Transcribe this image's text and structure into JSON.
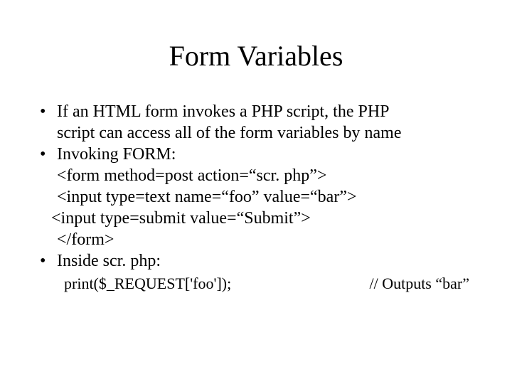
{
  "title": "Form Variables",
  "bullet1_line1": "If an HTML form invokes a PHP script, the PHP",
  "bullet1_line2": "script can access all of the form variables by name",
  "bullet2": "Invoking FORM:",
  "form_line1": "<form method=post action=“scr. php”>",
  "form_line2": "<input type=text name=“foo” value=“bar”>",
  "form_line3": "<input type=submit value=“Submit”>",
  "form_line4": "</form>",
  "bullet3": "Inside scr. php:",
  "code_left": "print($_REQUEST['foo']);",
  "code_right": "// Outputs “bar”"
}
